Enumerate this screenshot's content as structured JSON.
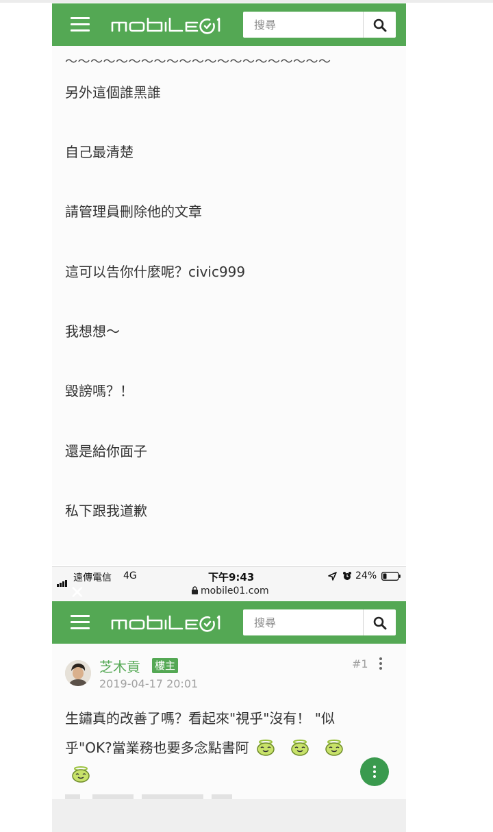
{
  "page_title": "mobile01",
  "search": {
    "placeholder": "搜尋"
  },
  "icons": {
    "menu": "hamburger-menu-icon",
    "logo": "mobile01-logo",
    "search": "search-icon",
    "more": "more-vertical-icon"
  },
  "colors": {
    "brand_green": "#54a854",
    "fab_green": "#3a9a4e",
    "meta_gray": "#a0a0a0"
  },
  "screenshot_top": {
    "wavy_line": "～～～～～～～～～～～～～～～～～～～～～",
    "lines": [
      "另外這個誰黑誰",
      "自己最清楚",
      "請管理員刪除他的文章",
      "這可以告你什麼呢？civic999",
      "我想想～",
      "毀謗嗎？！",
      "還是給你面子",
      "私下跟我道歉"
    ]
  },
  "screenshot_bottom": {
    "status_bar": {
      "carrier": "遠傳電信",
      "network": "4G",
      "time": "下午9:43",
      "battery": "24%"
    },
    "url": "mobile01.com",
    "post": {
      "author": "芝木貢",
      "badge": "樓主",
      "timestamp": "2019-04-17 20:01",
      "floor": "#1",
      "body_line1": "生鏽真的改善了嗎？看起來\"視乎\"沒有！ \"似",
      "body_line2": "乎\"OK?當業務也要多念點書阿"
    }
  }
}
